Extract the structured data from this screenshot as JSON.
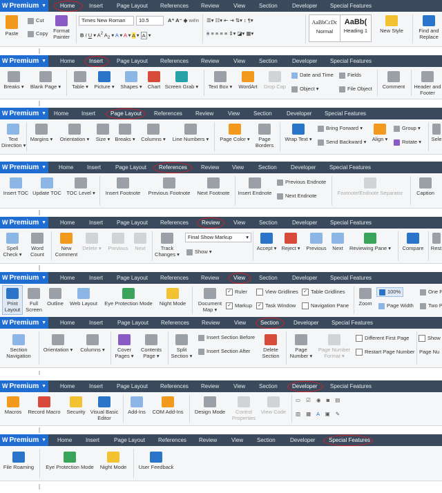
{
  "app": {
    "premium_label": "Premium"
  },
  "tabs": [
    "Home",
    "Insert",
    "Page Layout",
    "References",
    "Review",
    "View",
    "Section",
    "Developer",
    "Special Features"
  ],
  "home": {
    "paste": "Paste",
    "cut": "Cut",
    "copy": "Copy",
    "format_painter_1": "Format",
    "format_painter_2": "Painter",
    "font_name": "Times New Roman",
    "font_size": "10.5",
    "style_normal_preview": "AaBbCcDc",
    "style_normal": "Normal",
    "style_heading_preview": "AaBb(",
    "style_heading": "Heading 1",
    "new_style": "New Style",
    "find_replace_1": "Find and",
    "find_replace_2": "Replace"
  },
  "insert": {
    "breaks": "Breaks",
    "blank_page": "Blank Page",
    "table": "Table",
    "picture": "Picture",
    "shapes": "Shapes",
    "chart": "Chart",
    "screen_grab": "Screen Grab",
    "text_box": "Text Box",
    "wordart": "WordArt",
    "drop_cap": "Drop Cap",
    "date_time": "Date and Time",
    "object": "Object",
    "fields": "Fields",
    "file_object": "File Object",
    "comment": "Comment",
    "header_footer_1": "Header and",
    "header_footer_2": "Footer"
  },
  "page_layout": {
    "text_direction_1": "Text",
    "text_direction_2": "Direction",
    "margins": "Margins",
    "orientation": "Orientation",
    "size": "Size",
    "breaks": "Breaks",
    "columns": "Columns",
    "line_numbers": "Line Numbers",
    "page_color": "Page Color",
    "page_borders_1": "Page",
    "page_borders_2": "Borders",
    "wrap_text": "Wrap Text",
    "bring_forward": "Bring Forward",
    "send_backward": "Send Backward",
    "align": "Align",
    "group": "Group",
    "rotate": "Rotate",
    "select": "Sele"
  },
  "references": {
    "insert_toc": "Insert TOC",
    "update_toc": "Update TOC",
    "toc_level": "TOC Level",
    "insert_footnote": "Insert Footnote",
    "previous_footnote": "Previous Footnote",
    "next_footnote": "Next Footnote",
    "insert_endnote": "Insert Endnote",
    "previous_endnote": "Previous Endnote",
    "next_endnote": "Next Endnote",
    "separator": "Footnote/Endnote Separator",
    "caption": "Caption"
  },
  "review": {
    "spell_check_1": "Spell",
    "spell_check_2": "Check",
    "word_count_1": "Word",
    "word_count_2": "Count",
    "new_comment_1": "New",
    "new_comment_2": "Comment",
    "delete": "Delete",
    "previous": "Previous",
    "next": "Next",
    "track_changes_1": "Track",
    "track_changes_2": "Changes",
    "markup_mode": "Final Show Markup",
    "show": "Show",
    "accept": "Accept",
    "reject": "Reject",
    "previous2": "Previous",
    "next2": "Next",
    "reviewing_pane": "Reviewing Pane",
    "compare": "Compare",
    "restrict": "Rest"
  },
  "view": {
    "print_layout_1": "Print",
    "print_layout_2": "Layout",
    "full_screen_1": "Full",
    "full_screen_2": "Screen",
    "outline": "Outline",
    "web_layout": "Web Layout",
    "eye_protection": "Eye Protection Mode",
    "night_mode": "Night Mode",
    "document_map_1": "Document",
    "document_map_2": "Map",
    "ruler": "Ruler",
    "markup": "Markup",
    "view_gridlines": "View Gridlines",
    "task_window": "Task Window",
    "table_gridlines": "Table Gridlines",
    "navigation_pane": "Navigation Pane",
    "zoom": "Zoom",
    "zoom_value": "100%",
    "page_width": "Page Width",
    "one_page": "One P",
    "two_pages": "Two Pa"
  },
  "section": {
    "section_navigation_1": "Section",
    "section_navigation_2": "Navigation",
    "orientation": "Orientation",
    "columns": "Columns",
    "cover_pages_1": "Cover",
    "cover_pages_2": "Pages",
    "contents_page_1": "Contents",
    "contents_page_2": "Page",
    "split_section_1": "Split",
    "split_section_2": "Section",
    "insert_before": "Insert Section Before",
    "insert_after": "Insert Section After",
    "delete_section_1": "Delete",
    "delete_section_2": "Section",
    "page_number_1": "Page",
    "page_number_2": "Number",
    "page_number_format_1": "Page Number",
    "page_number_format_2": "Format",
    "different_first_page": "Different First Page",
    "restart_page_number": "Restart Page Number",
    "show": "Show",
    "page_nu": "Page Nu"
  },
  "developer": {
    "macros": "Macros",
    "record_macro": "Record Macro",
    "security": "Security",
    "vba_editor_1": "Visual Basic",
    "vba_editor_2": "Editor",
    "add_ins": "Add-Ins",
    "com_add_ins": "COM Add-Ins",
    "design_mode": "Design Mode",
    "control_properties_1": "Control",
    "control_properties_2": "Properties",
    "view_code": "View Code"
  },
  "special": {
    "file_roaming": "File Roaming",
    "eye_protection": "Eye Protection Mode",
    "night_mode": "Night Mode",
    "user_feedback": "User Feedback"
  },
  "colors": {
    "premium": "#1f6dd0",
    "tabbar": "#3a4a5c",
    "ribbon": "#f5f6f7",
    "highlight": "#d0202a"
  }
}
